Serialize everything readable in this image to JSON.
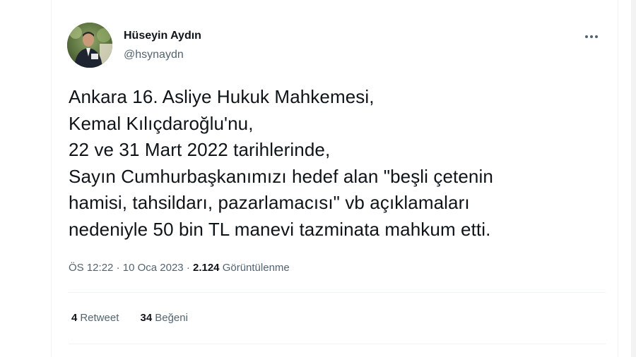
{
  "tweet": {
    "author": {
      "name": "Hüseyin Aydın",
      "handle": "@hsynaydn"
    },
    "more_icon": "more-horizontal-icon",
    "text_lines": [
      "Ankara 16. Asliye Hukuk Mahkemesi,",
      "Kemal Kılıçdaroğlu'nu,",
      "22 ve 31 Mart 2022 tarihlerinde,",
      "Sayın Cumhurbaşkanımızı hedef alan \"beşli çetenin",
      "hamisi, tahsildarı, pazarlamacısı\" vb açıklamaları",
      "nedeniyle 50 bin TL manevi tazminata mahkum etti."
    ],
    "meta": {
      "time": "ÖS 12:22",
      "separator": "·",
      "date": "10 Oca 2023",
      "views_count": "2.124",
      "views_label": "Görüntülenme"
    },
    "stats": {
      "retweets_count": "4",
      "retweets_label": "Retweet",
      "likes_count": "34",
      "likes_label": "Beğeni"
    }
  },
  "colors": {
    "text_primary": "#0f1419",
    "text_secondary": "#536471",
    "divider": "#eff3f4"
  }
}
